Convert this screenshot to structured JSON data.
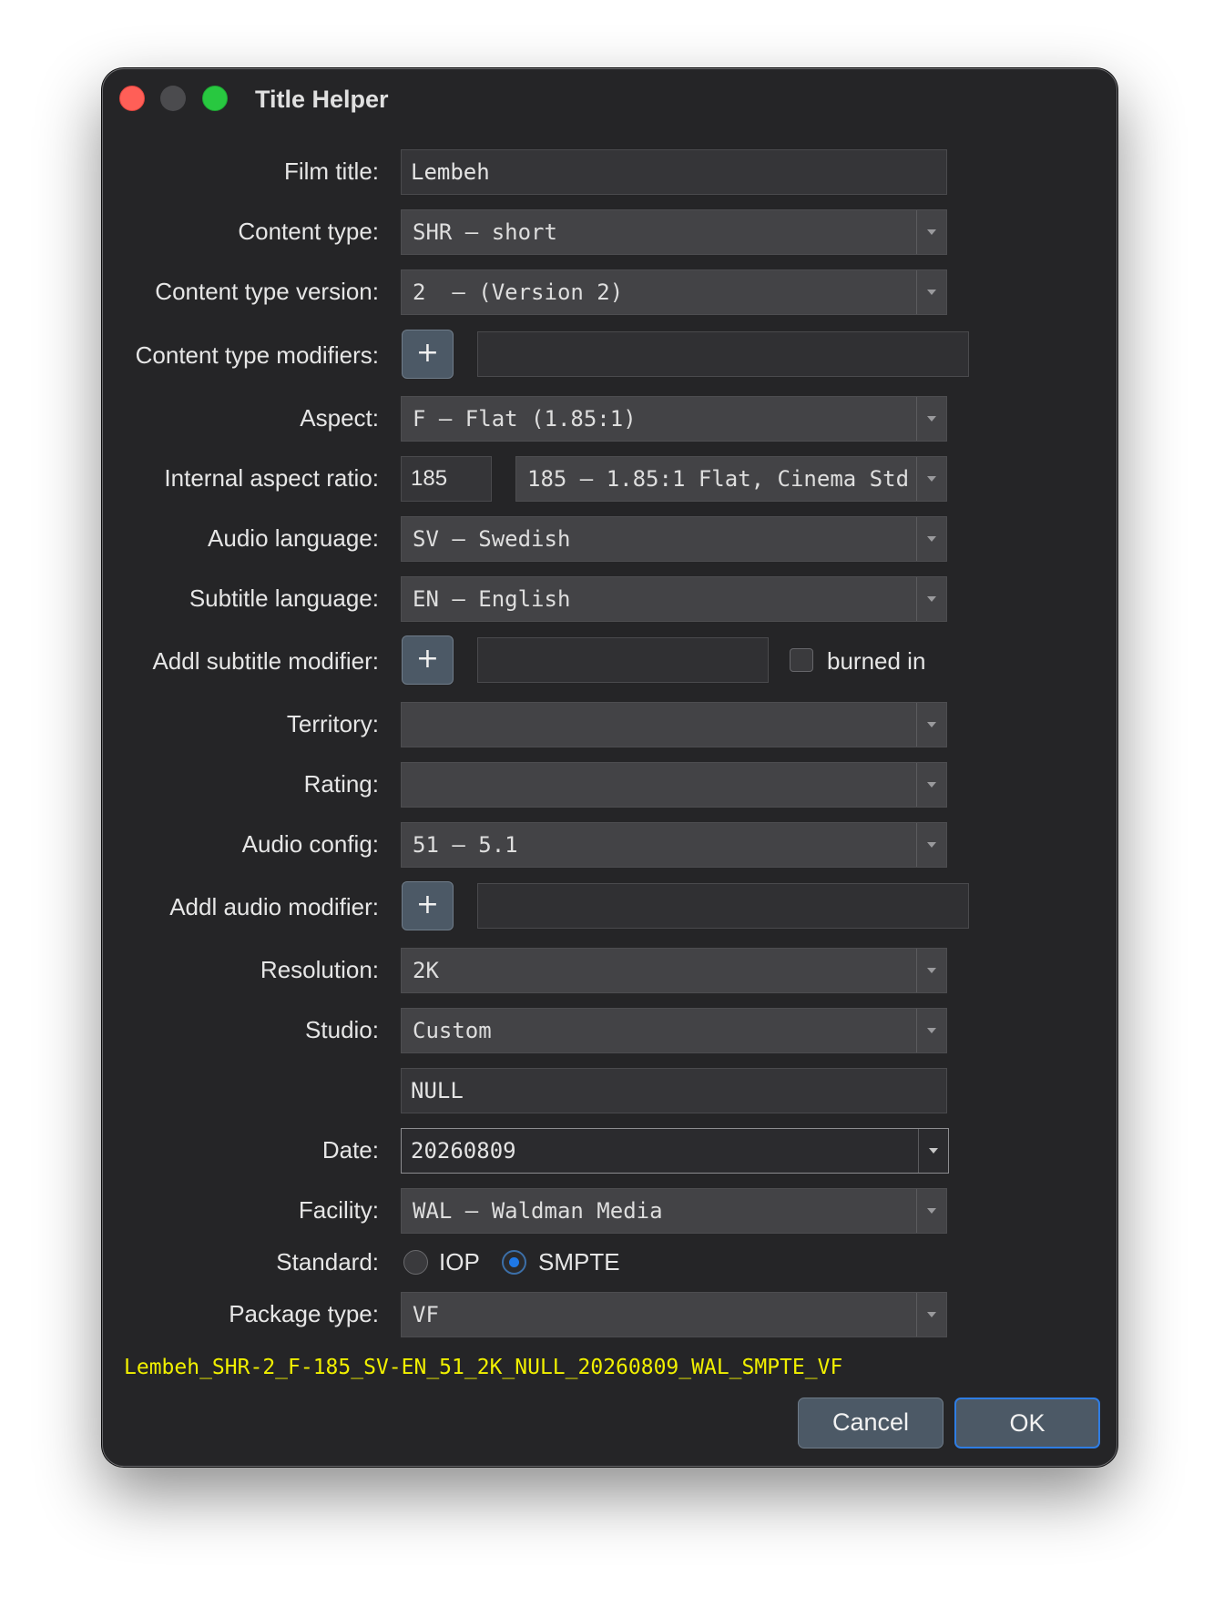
{
  "window": {
    "title": "Title Helper"
  },
  "labels": {
    "film_title": "Film title:",
    "content_type": "Content type:",
    "content_type_version": "Content type version:",
    "content_type_modifiers": "Content type modifiers:",
    "aspect": "Aspect:",
    "internal_aspect_ratio": "Internal aspect ratio:",
    "audio_language": "Audio language:",
    "subtitle_language": "Subtitle language:",
    "addl_subtitle_modifier": "Addl subtitle modifier:",
    "territory": "Territory:",
    "rating": "Rating:",
    "audio_config": "Audio config:",
    "addl_audio_modifier": "Addl audio modifier:",
    "resolution": "Resolution:",
    "studio": "Studio:",
    "date": "Date:",
    "facility": "Facility:",
    "standard": "Standard:",
    "package_type": "Package type:"
  },
  "values": {
    "film_title": "Lembeh",
    "content_type": "SHR – short",
    "content_type_version": "2  – (Version 2)",
    "content_type_modifiers": "",
    "aspect": "F – Flat (1.85:1)",
    "internal_aspect_ratio_text": "185",
    "internal_aspect_ratio_combo": "185 – 1.85:1 Flat, Cinema Std",
    "audio_language": "SV – Swedish",
    "subtitle_language": "EN – English",
    "addl_subtitle_modifier": "",
    "territory": "",
    "rating": "",
    "audio_config": "51 – 5.1",
    "addl_audio_modifier": "",
    "resolution": "2K",
    "studio": "Custom",
    "studio_custom": "NULL",
    "date": "20260809",
    "facility": "WAL – Waldman Media",
    "package_type": "VF"
  },
  "plus_label": "+",
  "burned_in": {
    "label": "burned in",
    "checked": false
  },
  "standard": {
    "options": [
      "IOP",
      "SMPTE"
    ],
    "selected": "SMPTE"
  },
  "generated_title": "Lembeh_SHR-2_F-185_SV-EN_51_2K_NULL_20260809_WAL_SMPTE_VF",
  "buttons": {
    "cancel": "Cancel",
    "ok": "OK"
  },
  "colors": {
    "accent": "#1f78e6",
    "generated_text": "#f1f000",
    "window_bg": "#252527"
  }
}
